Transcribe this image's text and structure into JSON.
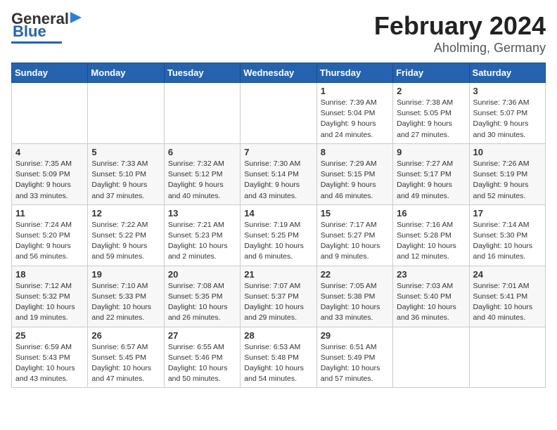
{
  "header": {
    "logo_general": "General",
    "logo_blue": "Blue",
    "month_title": "February 2024",
    "location": "Aholming, Germany"
  },
  "days_of_week": [
    "Sunday",
    "Monday",
    "Tuesday",
    "Wednesday",
    "Thursday",
    "Friday",
    "Saturday"
  ],
  "weeks": [
    [
      {
        "day": "",
        "sunrise": "",
        "sunset": "",
        "daylight": ""
      },
      {
        "day": "",
        "sunrise": "",
        "sunset": "",
        "daylight": ""
      },
      {
        "day": "",
        "sunrise": "",
        "sunset": "",
        "daylight": ""
      },
      {
        "day": "",
        "sunrise": "",
        "sunset": "",
        "daylight": ""
      },
      {
        "day": "1",
        "sunrise": "Sunrise: 7:39 AM",
        "sunset": "Sunset: 5:04 PM",
        "daylight": "Daylight: 9 hours and 24 minutes."
      },
      {
        "day": "2",
        "sunrise": "Sunrise: 7:38 AM",
        "sunset": "Sunset: 5:05 PM",
        "daylight": "Daylight: 9 hours and 27 minutes."
      },
      {
        "day": "3",
        "sunrise": "Sunrise: 7:36 AM",
        "sunset": "Sunset: 5:07 PM",
        "daylight": "Daylight: 9 hours and 30 minutes."
      }
    ],
    [
      {
        "day": "4",
        "sunrise": "Sunrise: 7:35 AM",
        "sunset": "Sunset: 5:09 PM",
        "daylight": "Daylight: 9 hours and 33 minutes."
      },
      {
        "day": "5",
        "sunrise": "Sunrise: 7:33 AM",
        "sunset": "Sunset: 5:10 PM",
        "daylight": "Daylight: 9 hours and 37 minutes."
      },
      {
        "day": "6",
        "sunrise": "Sunrise: 7:32 AM",
        "sunset": "Sunset: 5:12 PM",
        "daylight": "Daylight: 9 hours and 40 minutes."
      },
      {
        "day": "7",
        "sunrise": "Sunrise: 7:30 AM",
        "sunset": "Sunset: 5:14 PM",
        "daylight": "Daylight: 9 hours and 43 minutes."
      },
      {
        "day": "8",
        "sunrise": "Sunrise: 7:29 AM",
        "sunset": "Sunset: 5:15 PM",
        "daylight": "Daylight: 9 hours and 46 minutes."
      },
      {
        "day": "9",
        "sunrise": "Sunrise: 7:27 AM",
        "sunset": "Sunset: 5:17 PM",
        "daylight": "Daylight: 9 hours and 49 minutes."
      },
      {
        "day": "10",
        "sunrise": "Sunrise: 7:26 AM",
        "sunset": "Sunset: 5:19 PM",
        "daylight": "Daylight: 9 hours and 52 minutes."
      }
    ],
    [
      {
        "day": "11",
        "sunrise": "Sunrise: 7:24 AM",
        "sunset": "Sunset: 5:20 PM",
        "daylight": "Daylight: 9 hours and 56 minutes."
      },
      {
        "day": "12",
        "sunrise": "Sunrise: 7:22 AM",
        "sunset": "Sunset: 5:22 PM",
        "daylight": "Daylight: 9 hours and 59 minutes."
      },
      {
        "day": "13",
        "sunrise": "Sunrise: 7:21 AM",
        "sunset": "Sunset: 5:23 PM",
        "daylight": "Daylight: 10 hours and 2 minutes."
      },
      {
        "day": "14",
        "sunrise": "Sunrise: 7:19 AM",
        "sunset": "Sunset: 5:25 PM",
        "daylight": "Daylight: 10 hours and 6 minutes."
      },
      {
        "day": "15",
        "sunrise": "Sunrise: 7:17 AM",
        "sunset": "Sunset: 5:27 PM",
        "daylight": "Daylight: 10 hours and 9 minutes."
      },
      {
        "day": "16",
        "sunrise": "Sunrise: 7:16 AM",
        "sunset": "Sunset: 5:28 PM",
        "daylight": "Daylight: 10 hours and 12 minutes."
      },
      {
        "day": "17",
        "sunrise": "Sunrise: 7:14 AM",
        "sunset": "Sunset: 5:30 PM",
        "daylight": "Daylight: 10 hours and 16 minutes."
      }
    ],
    [
      {
        "day": "18",
        "sunrise": "Sunrise: 7:12 AM",
        "sunset": "Sunset: 5:32 PM",
        "daylight": "Daylight: 10 hours and 19 minutes."
      },
      {
        "day": "19",
        "sunrise": "Sunrise: 7:10 AM",
        "sunset": "Sunset: 5:33 PM",
        "daylight": "Daylight: 10 hours and 22 minutes."
      },
      {
        "day": "20",
        "sunrise": "Sunrise: 7:08 AM",
        "sunset": "Sunset: 5:35 PM",
        "daylight": "Daylight: 10 hours and 26 minutes."
      },
      {
        "day": "21",
        "sunrise": "Sunrise: 7:07 AM",
        "sunset": "Sunset: 5:37 PM",
        "daylight": "Daylight: 10 hours and 29 minutes."
      },
      {
        "day": "22",
        "sunrise": "Sunrise: 7:05 AM",
        "sunset": "Sunset: 5:38 PM",
        "daylight": "Daylight: 10 hours and 33 minutes."
      },
      {
        "day": "23",
        "sunrise": "Sunrise: 7:03 AM",
        "sunset": "Sunset: 5:40 PM",
        "daylight": "Daylight: 10 hours and 36 minutes."
      },
      {
        "day": "24",
        "sunrise": "Sunrise: 7:01 AM",
        "sunset": "Sunset: 5:41 PM",
        "daylight": "Daylight: 10 hours and 40 minutes."
      }
    ],
    [
      {
        "day": "25",
        "sunrise": "Sunrise: 6:59 AM",
        "sunset": "Sunset: 5:43 PM",
        "daylight": "Daylight: 10 hours and 43 minutes."
      },
      {
        "day": "26",
        "sunrise": "Sunrise: 6:57 AM",
        "sunset": "Sunset: 5:45 PM",
        "daylight": "Daylight: 10 hours and 47 minutes."
      },
      {
        "day": "27",
        "sunrise": "Sunrise: 6:55 AM",
        "sunset": "Sunset: 5:46 PM",
        "daylight": "Daylight: 10 hours and 50 minutes."
      },
      {
        "day": "28",
        "sunrise": "Sunrise: 6:53 AM",
        "sunset": "Sunset: 5:48 PM",
        "daylight": "Daylight: 10 hours and 54 minutes."
      },
      {
        "day": "29",
        "sunrise": "Sunrise: 6:51 AM",
        "sunset": "Sunset: 5:49 PM",
        "daylight": "Daylight: 10 hours and 57 minutes."
      },
      {
        "day": "",
        "sunrise": "",
        "sunset": "",
        "daylight": ""
      },
      {
        "day": "",
        "sunrise": "",
        "sunset": "",
        "daylight": ""
      }
    ]
  ]
}
